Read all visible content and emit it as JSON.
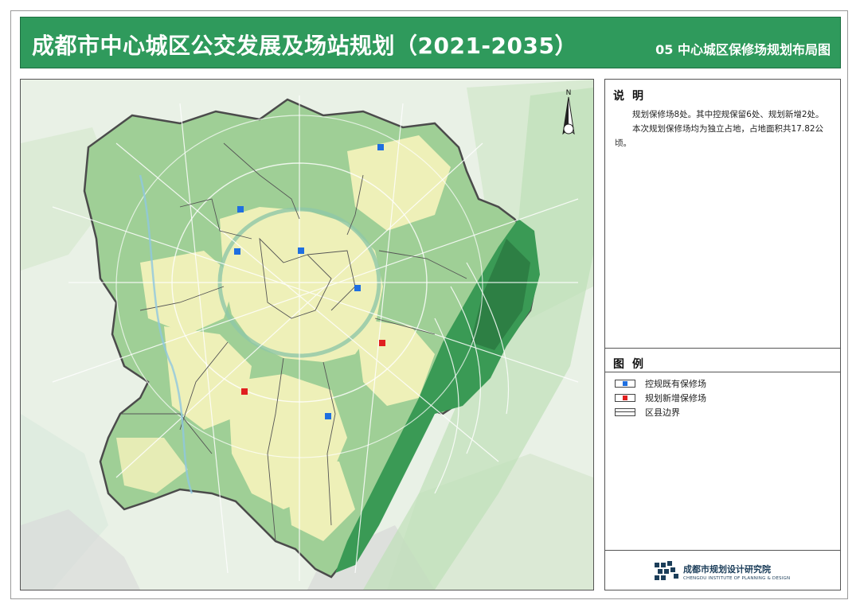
{
  "header": {
    "title": "成都市中心城区公交发展及场站规划（2021-2035）",
    "subtitle": "05 中心城区保修场规划布局图"
  },
  "description": {
    "heading": "说明",
    "paragraphs": [
      "规划保修场8处。其中控规保留6处、规划新增2处。",
      "本次规划保修场均为独立占地，占地面积共17.82公顷。"
    ]
  },
  "legend": {
    "heading": "图例",
    "items": [
      {
        "label": "控规既有保修场",
        "color": "#1f6fe0"
      },
      {
        "label": "规划新增保修场",
        "color": "#e01f1f"
      },
      {
        "label": "区县边界"
      }
    ]
  },
  "compass": {
    "label": "N"
  },
  "logo": {
    "name": "成都市规划设计研究院",
    "english": "CHENGDU INSTITUTE OF PLANNING & DESIGN"
  },
  "colors": {
    "header": "#2f9a5c",
    "existing_depot": "#1f6fe0",
    "new_depot": "#e01f1f",
    "urban_fill": "#eef0b8",
    "district_fill": "#9ccc94",
    "mountain_fill": "#3a9a55"
  },
  "map": {
    "existing_depot_count": 6,
    "new_depot_count": 2
  }
}
